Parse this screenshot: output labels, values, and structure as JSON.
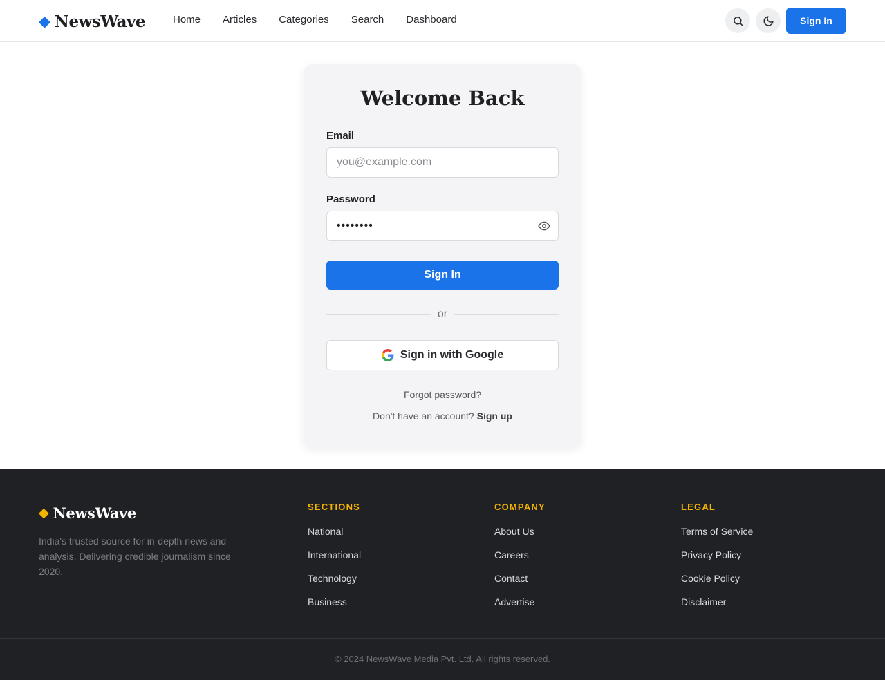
{
  "header": {
    "brand": "NewsWave",
    "nav": [
      "Home",
      "Articles",
      "Categories",
      "Search",
      "Dashboard"
    ],
    "signin_label": "Sign In"
  },
  "login": {
    "title": "Welcome Back",
    "email_label": "Email",
    "email_placeholder": "you@example.com",
    "password_label": "Password",
    "password_value": "••••••••",
    "submit_label": "Sign In",
    "divider_text": "or",
    "google_label": "Sign in with Google",
    "forgot_label": "Forgot password?",
    "signup_prompt": "Don't have an account?",
    "signup_link": "Sign up"
  },
  "footer": {
    "brand": "NewsWave",
    "description": "India's trusted source for in-depth news and analysis. Delivering credible journalism since 2020.",
    "columns": [
      {
        "title": "SECTIONS",
        "links": [
          "National",
          "International",
          "Technology",
          "Business"
        ]
      },
      {
        "title": "COMPANY",
        "links": [
          "About Us",
          "Careers",
          "Contact",
          "Advertise"
        ]
      },
      {
        "title": "LEGAL",
        "links": [
          "Terms of Service",
          "Privacy Policy",
          "Cookie Policy",
          "Disclaimer"
        ]
      }
    ],
    "copyright": "© 2024 NewsWave Media Pvt. Ltd. All rights reserved."
  },
  "icons": [
    "diamond-logo-icon",
    "search-icon",
    "moon-icon",
    "eye-icon",
    "google-icon"
  ],
  "colors": {
    "primary": "#1a73e8",
    "accent": "#f4b400",
    "footer_bg": "#202124"
  }
}
